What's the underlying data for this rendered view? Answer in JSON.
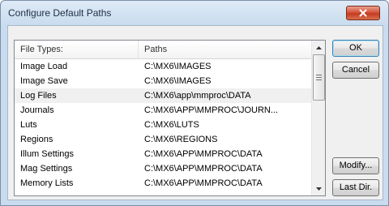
{
  "window": {
    "title": "Configure Default Paths"
  },
  "icons": {
    "close": "close-x-icon",
    "scroll_up": "arrow-up-icon",
    "scroll_down": "arrow-down-icon"
  },
  "list": {
    "headers": {
      "type": "File Types:",
      "path": "Paths"
    },
    "selected_index": 2,
    "rows": [
      {
        "type": "Image Load",
        "path": "C:\\MX6\\IMAGES"
      },
      {
        "type": "Image Save",
        "path": "C:\\MX6\\IMAGES"
      },
      {
        "type": "Log Files",
        "path": "C:\\MX6\\app\\mmproc\\DATA"
      },
      {
        "type": "Journals",
        "path": "C:\\MX6\\APP\\MMPROC\\JOURN..."
      },
      {
        "type": "Luts",
        "path": "C:\\MX6\\LUTS"
      },
      {
        "type": "Regions",
        "path": "C:\\MX6\\REGIONS"
      },
      {
        "type": "Illum Settings",
        "path": "C:\\MX6\\APP\\MMPROC\\DATA"
      },
      {
        "type": "Mag Settings",
        "path": "C:\\MX6\\APP\\MMPROC\\DATA"
      },
      {
        "type": "Memory Lists",
        "path": "C:\\MX6\\APP\\MMPROC\\DATA"
      }
    ]
  },
  "buttons": {
    "ok": "OK",
    "cancel": "Cancel",
    "modify": "Modify...",
    "last_dir": "Last Dir."
  },
  "colors": {
    "close_button": "#c9462b",
    "default_button_border": "#3c7fb1"
  }
}
